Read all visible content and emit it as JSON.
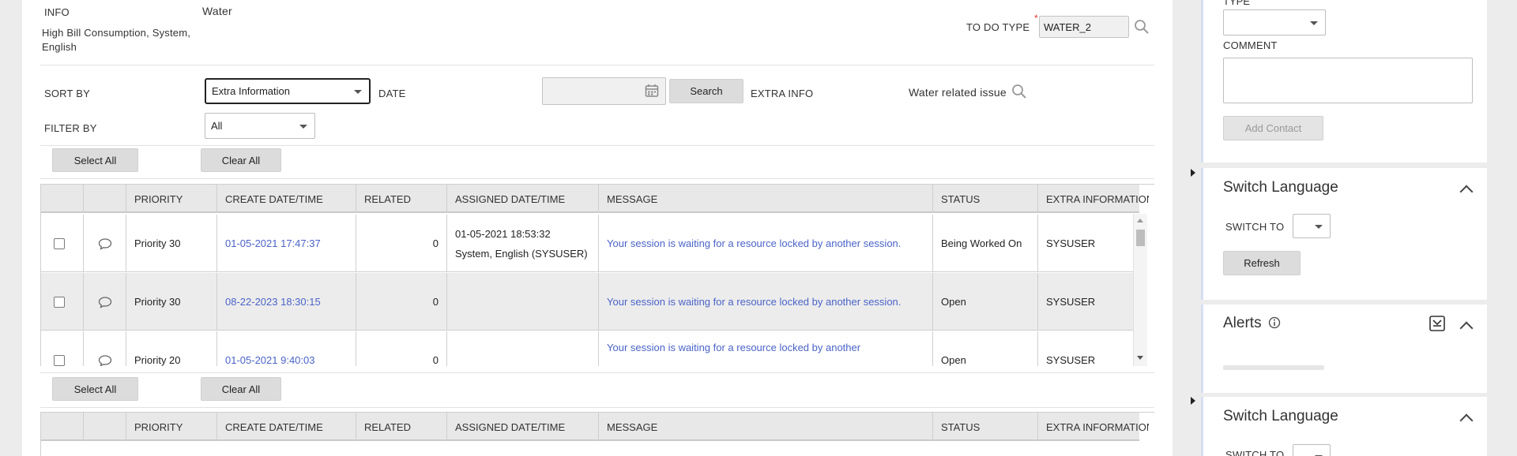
{
  "info": {
    "label": "INFO",
    "value": "Water",
    "description": "High Bill Consumption, System, English"
  },
  "todo_type": {
    "label": "TO DO TYPE",
    "value": "WATER_2",
    "required_mark": "*"
  },
  "sort": {
    "label": "SORT BY",
    "value": "Extra Information"
  },
  "date": {
    "label": "DATE",
    "value": ""
  },
  "search_button": "Search",
  "extra_info": {
    "label": "EXTRA INFO",
    "value": "Water related issue"
  },
  "filter": {
    "label": "FILTER BY",
    "value": "All"
  },
  "select_all": "Select All",
  "clear_all": "Clear All",
  "table": {
    "columns": [
      "PRIORITY",
      "CREATE DATE/TIME",
      "RELATED",
      "ASSIGNED DATE/TIME",
      "MESSAGE",
      "STATUS",
      "EXTRA INFORMATION"
    ],
    "rows": [
      {
        "priority": "Priority 30",
        "create": "01-05-2021 17:47:37",
        "related": "0",
        "assigned_line1": "01-05-2021 18:53:32",
        "assigned_line2": "System, English (SYSUSER)",
        "message": "Your session is waiting for a resource locked by another session.",
        "status": "Being Worked On",
        "extra": "SYSUSER"
      },
      {
        "priority": "Priority 30",
        "create": "08-22-2023 18:30:15",
        "related": "0",
        "assigned_line1": "",
        "assigned_line2": "",
        "message": "Your session is waiting for a resource locked by another session.",
        "status": "Open",
        "extra": "SYSUSER"
      },
      {
        "priority": "Priority 20",
        "create": "01-05-2021 9:40:03",
        "related": "0",
        "assigned_line1": "",
        "assigned_line2": "",
        "message": "Your session is waiting for a resource locked by another",
        "status": "Open",
        "extra": "SYSUSER"
      }
    ]
  },
  "right": {
    "type_label": "TYPE",
    "type_value": "",
    "comment_label": "COMMENT",
    "comment_value": "",
    "add_contact": "Add Contact",
    "switch_language_title": "Switch Language",
    "switch_to_label": "SWITCH TO",
    "switch_to_value": "",
    "refresh": "Refresh",
    "alerts_title": "Alerts",
    "switch_language_title_2": "Switch Language",
    "switch_to_label_2": "SWITCH TO"
  },
  "colors": {
    "link": "#4a63c8",
    "button": "#dcdcdc",
    "panel_accent": "#d6dff2"
  }
}
